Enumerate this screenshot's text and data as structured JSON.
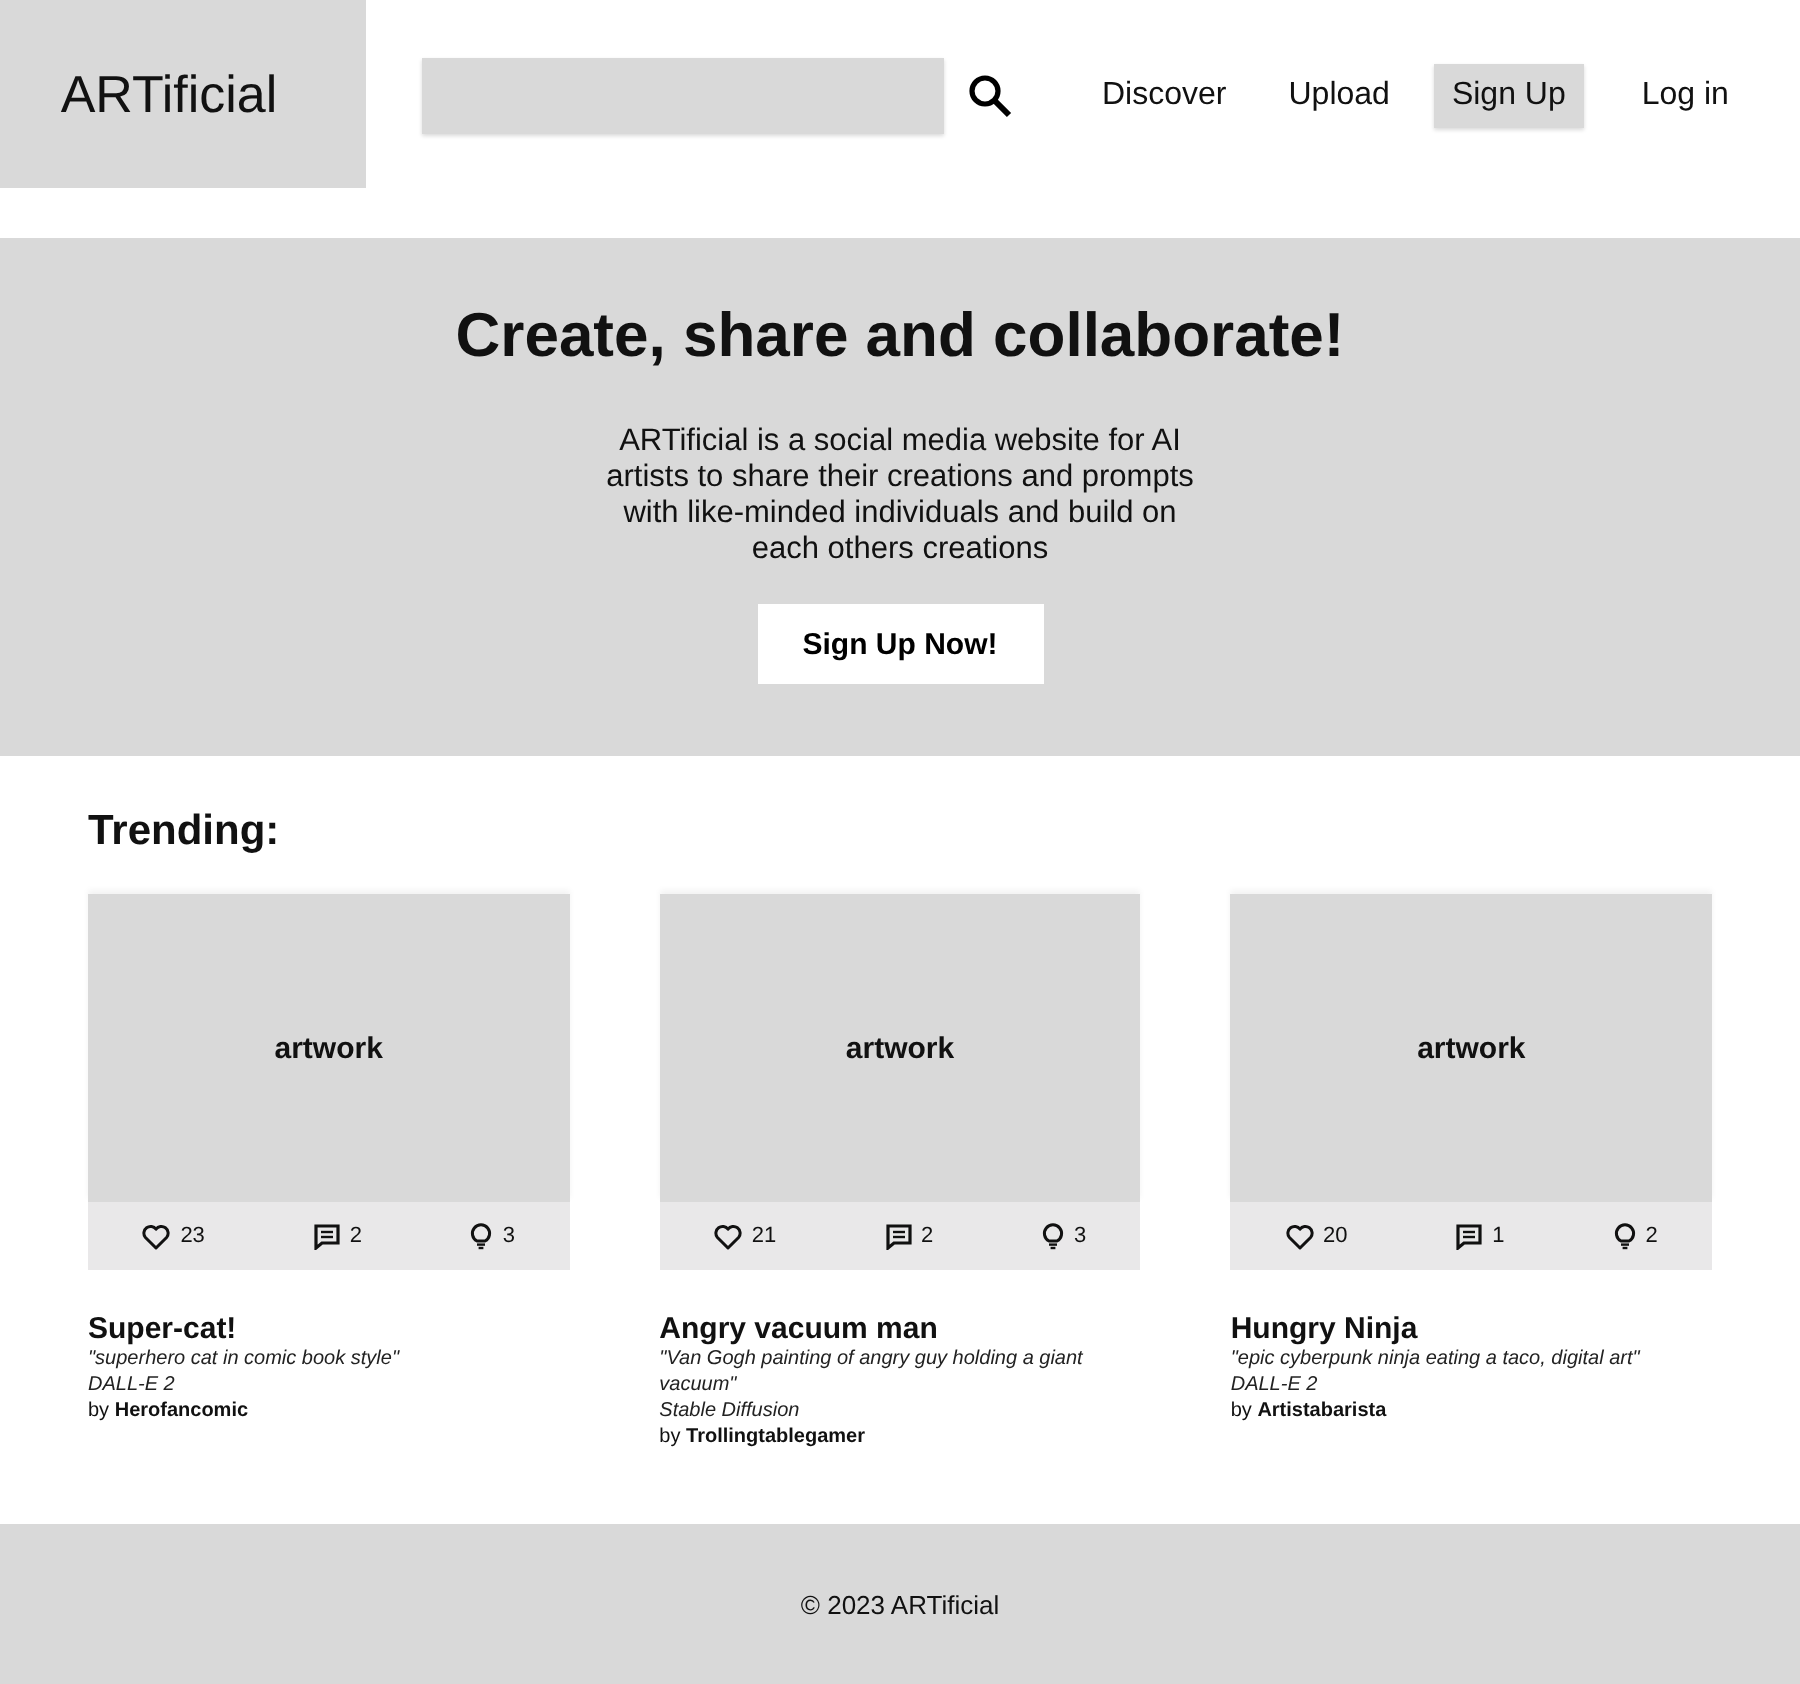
{
  "logo": "ARTificial",
  "nav": [
    {
      "label": "Discover",
      "kind": "link"
    },
    {
      "label": "Upload",
      "kind": "link"
    },
    {
      "label": "Sign Up",
      "kind": "button"
    },
    {
      "label": "Log in",
      "kind": "link"
    }
  ],
  "hero": {
    "title": "Create, share and collaborate!",
    "text": "ARTificial is a social media website for AI artists to share their creations and prompts with like-minded individuals and build on each others creations",
    "button": "Sign Up Now!"
  },
  "trending": {
    "heading": "Trending:",
    "cards": [
      {
        "image_label": "artwork",
        "likes": "23",
        "comments": "2",
        "ideas": "3",
        "title": "Super-cat!",
        "prompt": "\"superhero cat in comic book style\"",
        "model": "DALL-E 2",
        "author": "by **Herofancomic**"
      },
      {
        "image_label": "artwork",
        "likes": "21",
        "comments": "2",
        "ideas": "3",
        "title": "Angry vacuum man",
        "prompt": "\"Van Gogh painting of angry guy holding a giant vacuum\"",
        "model": "Stable Diffusion",
        "author": "by **Trollingtablegamer**"
      },
      {
        "image_label": "artwork",
        "likes": "20",
        "comments": "1",
        "ideas": "2",
        "title": "Hungry Ninja",
        "prompt": "\"epic cyberpunk ninja eating a taco, digital art\"",
        "model": "DALL-E 2",
        "author": "by **Artistabarista**"
      }
    ]
  },
  "footer": "© 2023 ARTificial"
}
